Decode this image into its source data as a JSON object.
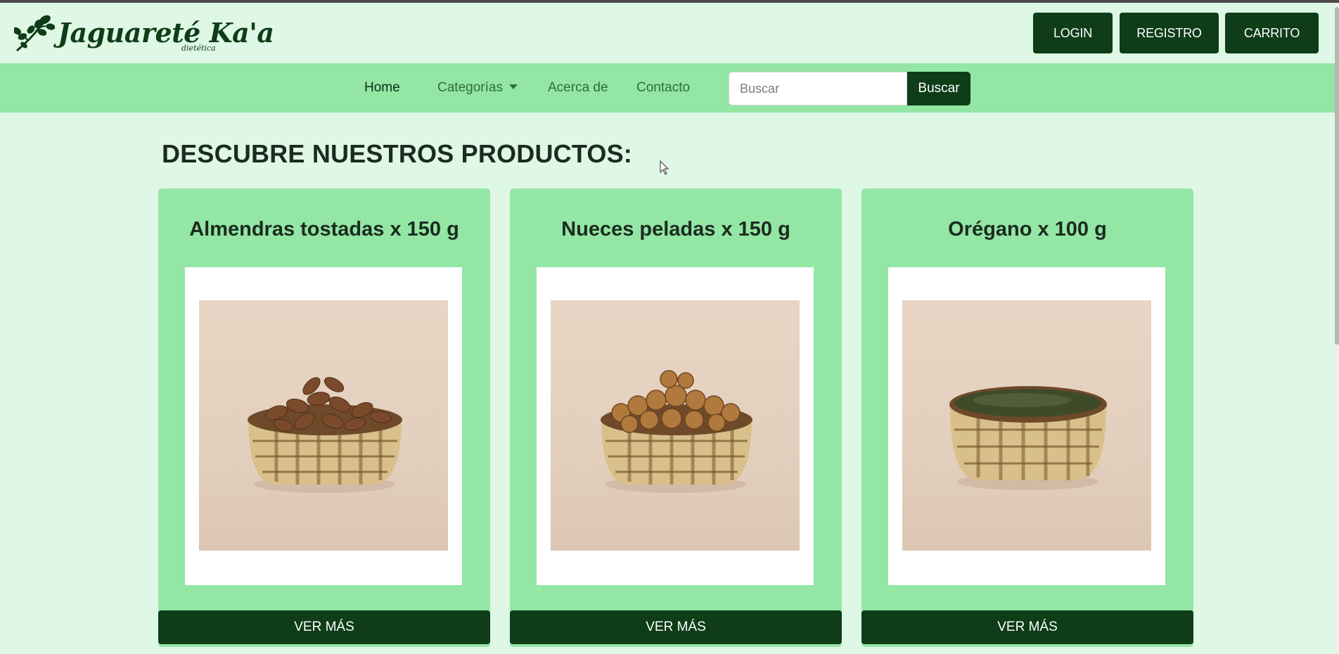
{
  "brand": {
    "name": "Jaguareté Ka'a",
    "tagline": "dietética",
    "color": "#0e3d18"
  },
  "header": {
    "login_label": "LOGIN",
    "register_label": "REGISTRO",
    "cart_label": "CARRITO"
  },
  "nav": {
    "home": "Home",
    "categories": "Categorías",
    "about": "Acerca de",
    "contact": "Contacto",
    "search_placeholder": "Buscar",
    "search_button": "Buscar"
  },
  "main": {
    "title": "DESCUBRE NUESTROS PRODUCTOS:",
    "products": [
      {
        "name": "Almendras tostadas x 150 g",
        "image_icon": "almond-basket-image",
        "button": "VER MÁS"
      },
      {
        "name": "Nueces peladas x 150 g",
        "image_icon": "walnut-basket-image",
        "button": "VER MÁS"
      },
      {
        "name": "Orégano x 100 g",
        "image_icon": "oregano-basket-image",
        "button": "VER MÁS"
      }
    ]
  },
  "colors": {
    "page_bg": "#dff7e5",
    "nav_bg": "#93e6a4",
    "accent": "#0e3d18"
  }
}
